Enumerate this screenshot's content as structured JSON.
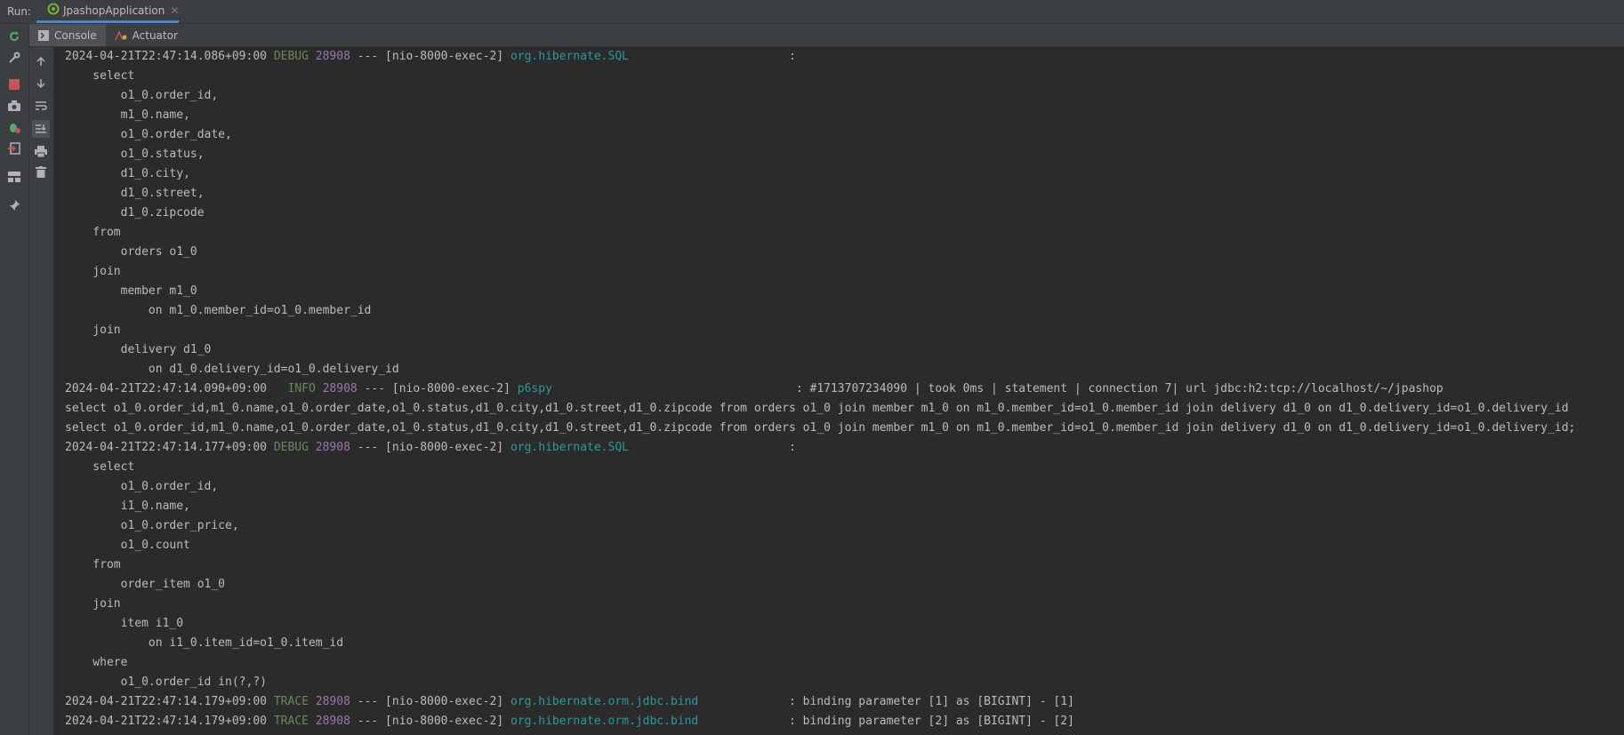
{
  "run_bar": {
    "label": "Run:",
    "tab_title": "JpashopApplication"
  },
  "sub_tabs": [
    {
      "label": "Console",
      "icon": "console-icon"
    },
    {
      "label": "Actuator",
      "icon": "actuator-icon"
    }
  ],
  "left_toolbar": [
    "rerun-icon",
    "wrench-icon",
    "stop-icon",
    "camera-icon",
    "debug-icon",
    "exit-icon",
    "layout-icon",
    "pin-icon"
  ],
  "console_toolbar": [
    "up-arrow-icon",
    "down-arrow-icon",
    "soft-wrap-icon",
    "scroll-to-end-icon",
    "print-icon",
    "trash-icon"
  ],
  "console": {
    "log1": {
      "ts": "2024-04-21T22:47:14.086+09:00",
      "level": "DEBUG",
      "pid": "28908",
      "mid": " --- [nio-8000-exec-2] ",
      "logger": "org.hibernate.SQL",
      "rest": "                       :"
    },
    "sql1": [
      "    select",
      "        o1_0.order_id,",
      "        m1_0.name,",
      "        o1_0.order_date,",
      "        o1_0.status,",
      "        d1_0.city,",
      "        d1_0.street,",
      "        d1_0.zipcode",
      "    from",
      "        orders o1_0",
      "    join",
      "        member m1_0",
      "            on m1_0.member_id=o1_0.member_id",
      "    join",
      "        delivery d1_0",
      "            on d1_0.delivery_id=o1_0.delivery_id"
    ],
    "log2": {
      "ts": "2024-04-21T22:47:14.090+09:00",
      "level": "  INFO",
      "pid": "28908",
      "mid": " --- [nio-8000-exec-2] ",
      "logger": "p6spy",
      "rest": "                                   : #1713707234090 | took 0ms | statement | connection 7| url jdbc:h2:tcp://localhost/~/jpashop"
    },
    "plain": [
      "select o1_0.order_id,m1_0.name,o1_0.order_date,o1_0.status,d1_0.city,d1_0.street,d1_0.zipcode from orders o1_0 join member m1_0 on m1_0.member_id=o1_0.member_id join delivery d1_0 on d1_0.delivery_id=o1_0.delivery_id",
      "select o1_0.order_id,m1_0.name,o1_0.order_date,o1_0.status,d1_0.city,d1_0.street,d1_0.zipcode from orders o1_0 join member m1_0 on m1_0.member_id=o1_0.member_id join delivery d1_0 on d1_0.delivery_id=o1_0.delivery_id;"
    ],
    "log3": {
      "ts": "2024-04-21T22:47:14.177+09:00",
      "level": "DEBUG",
      "pid": "28908",
      "mid": " --- [nio-8000-exec-2] ",
      "logger": "org.hibernate.SQL",
      "rest": "                       :"
    },
    "sql2": [
      "    select",
      "        o1_0.order_id,",
      "        i1_0.name,",
      "        o1_0.order_price,",
      "        o1_0.count",
      "    from",
      "        order_item o1_0",
      "    join",
      "        item i1_0",
      "            on i1_0.item_id=o1_0.item_id",
      "    where",
      "        o1_0.order_id in(?,?)"
    ],
    "log4": {
      "ts": "2024-04-21T22:47:14.179+09:00",
      "level": "TRACE",
      "pid": "28908",
      "mid": " --- [nio-8000-exec-2] ",
      "logger": "org.hibernate.orm.jdbc.bind",
      "rest": "             : binding parameter [1] as [BIGINT] - [1]"
    },
    "log5": {
      "ts": "2024-04-21T22:47:14.179+09:00",
      "level": "TRACE",
      "pid": "28908",
      "mid": " --- [nio-8000-exec-2] ",
      "logger": "org.hibernate.orm.jdbc.bind",
      "rest": "             : binding parameter [2] as [BIGINT] - [2]"
    }
  }
}
